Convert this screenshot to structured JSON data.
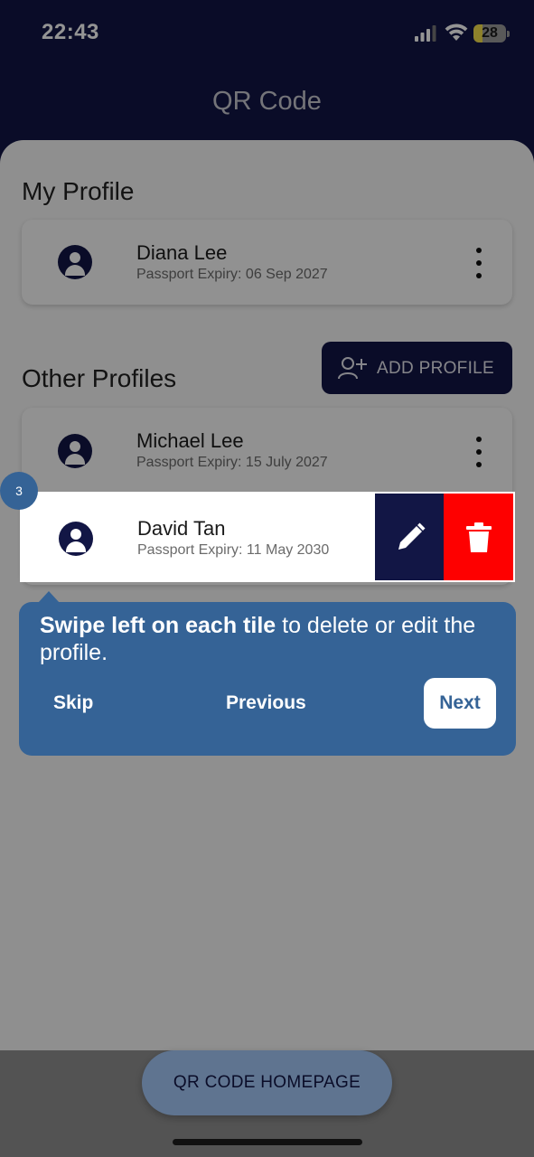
{
  "status_bar": {
    "time": "22:43",
    "battery": "28",
    "battery_level": 0.28
  },
  "header": {
    "title": "QR Code"
  },
  "my_profile": {
    "section_title": "My Profile",
    "profile": {
      "name": "Diana Lee",
      "expiry": "Passport Expiry: 06 Sep 2027"
    }
  },
  "other_profiles": {
    "section_title": "Other Profiles",
    "add_button_label": "ADD PROFILE",
    "profiles": [
      {
        "name": "Michael Lee",
        "expiry": "Passport Expiry: 15 July 2027"
      },
      {
        "name": "David Tan",
        "expiry": "Passport Expiry: 11 May 2030"
      }
    ]
  },
  "tutorial": {
    "step": "3",
    "text_bold": "Swipe left on each tile",
    "text_rest": " to delete or edit the profile.",
    "skip_label": "Skip",
    "previous_label": "Previous",
    "next_label": "Next"
  },
  "footer": {
    "home_button_label": "QR CODE HOMEPAGE"
  },
  "colors": {
    "primary": "#121645",
    "tutorial": "#356396",
    "delete": "#fe0000",
    "home_button": "#a4c8f8"
  }
}
